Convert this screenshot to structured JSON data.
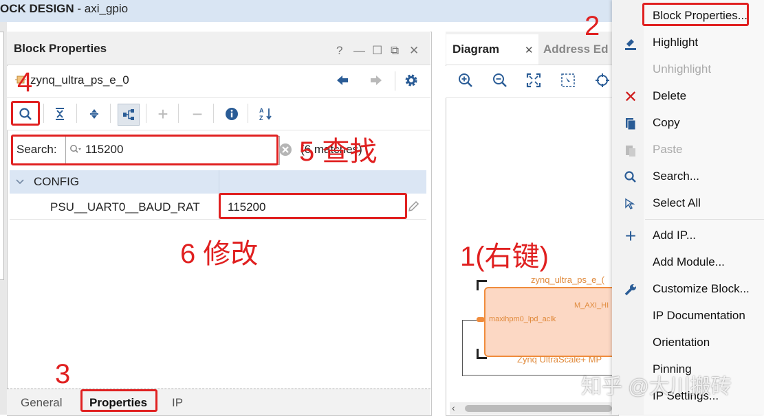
{
  "window": {
    "title_bold": "OCK DESIGN",
    "title_rest": " - axi_gpio"
  },
  "block_panel": {
    "title": "Block Properties",
    "header_buttons": [
      "?",
      "—",
      "☐",
      "⧉",
      "✕"
    ],
    "block_name": "zynq_ultra_ps_e_0",
    "search_label": "Search:",
    "search_value": "115200",
    "matches": "(6 matches)",
    "group": "CONFIG",
    "property_name": "PSU__UART0__BAUD_RAT",
    "property_value": "115200",
    "tabs": [
      "General",
      "Properties",
      "IP"
    ]
  },
  "diagram_panel": {
    "tab_diagram": "Diagram",
    "tab_address": "Address Ed",
    "block_title": "zynq_ultra_ps_e_(",
    "port_left": "maxihpm0_lpd_aclk",
    "port_right": "M_AXI_HI",
    "block_footer": "Zynq UltraScale+ MP"
  },
  "context_menu": {
    "items": [
      {
        "label": "Block Properties...",
        "icon": "properties-icon",
        "enabled": true
      },
      {
        "label": "Highlight",
        "icon": "highlight-icon",
        "enabled": true
      },
      {
        "label": "Unhighlight",
        "icon": "",
        "enabled": false
      },
      {
        "label": "Delete",
        "icon": "delete-icon",
        "enabled": true
      },
      {
        "label": "Copy",
        "icon": "copy-icon",
        "enabled": true
      },
      {
        "label": "Paste",
        "icon": "paste-icon",
        "enabled": false
      },
      {
        "label": "Search...",
        "icon": "search-icon",
        "enabled": true
      },
      {
        "label": "Select All",
        "icon": "select-all-icon",
        "enabled": true
      },
      {
        "label": "Add IP...",
        "icon": "add-icon",
        "enabled": true
      },
      {
        "label": "Add Module...",
        "icon": "",
        "enabled": true
      },
      {
        "label": "Customize Block...",
        "icon": "wrench-icon",
        "enabled": true
      },
      {
        "label": "IP Documentation",
        "icon": "",
        "enabled": true
      },
      {
        "label": "Orientation",
        "icon": "",
        "enabled": true
      },
      {
        "label": "Pinning",
        "icon": "",
        "enabled": true
      },
      {
        "label": "IP Settings...",
        "icon": "",
        "enabled": true
      }
    ]
  },
  "annotations": {
    "a1": "1(右键)",
    "a2": "2",
    "a3": "3",
    "a4": "4",
    "a5": "5 查找",
    "a6": "6 修改"
  },
  "watermark": "知乎 @大川搬砖",
  "colors": {
    "accent_red": "#e02020",
    "title_bar": "#d9e5f3",
    "config_row": "#dbe6f4",
    "block_fill": "#fcd8c4",
    "block_border": "#f08c3c"
  }
}
